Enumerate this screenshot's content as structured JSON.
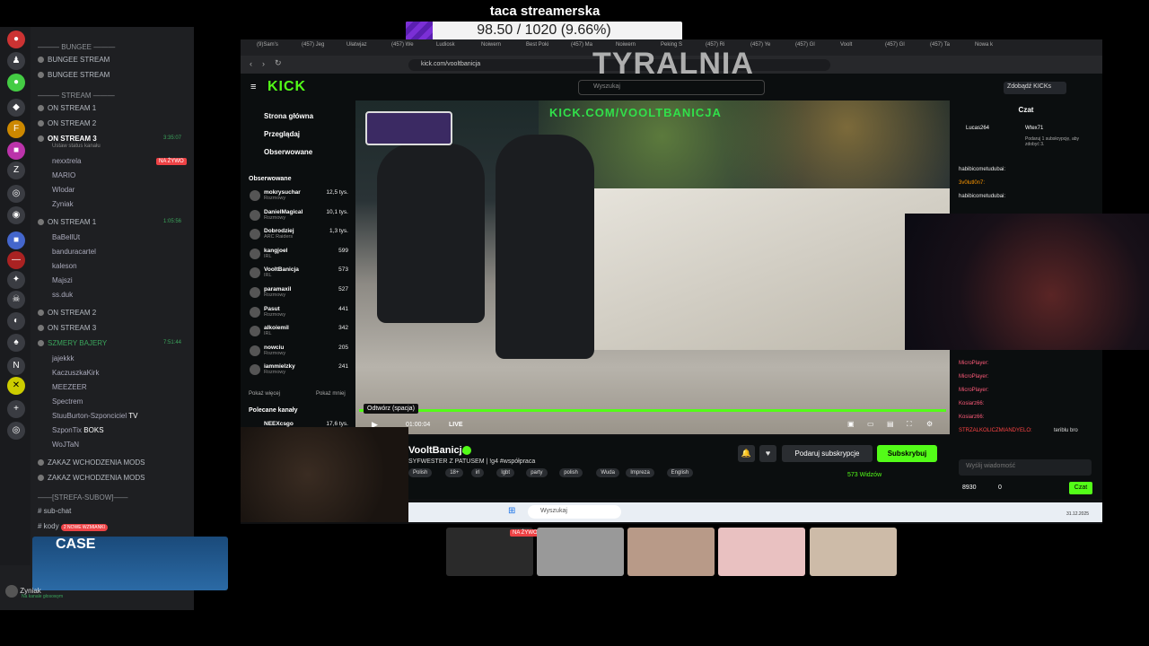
{
  "goal": {
    "title": "taca streamerska",
    "progress_text": "98.50 / 1020 (9.66%)",
    "progress_fraction": 0.0966
  },
  "discord": {
    "categories": {
      "bungee": "BUNGEE",
      "stream": "STREAM",
      "strefa": "STREFA-SUBOW"
    },
    "channels": {
      "bungee1": "BUNGEE STREAM",
      "bungee2": "BUNGEE STREAM",
      "on1": "ON STREAM 1",
      "on2": "ON STREAM 2",
      "on3": "ON STREAM 3",
      "on3_sub": "Ustaw status kanału",
      "on1b": "ON STREAM 1",
      "on2b": "ON STREAM 2",
      "on3b": "ON STREAM 3",
      "szmery": "SZMERY BAJERY",
      "zakaz1": "ZAKAZ WCHODZENIA MODS",
      "zakaz2": "ZAKAZ WCHODZENIA MODS",
      "subchat": "sub-chat",
      "kody": "kody",
      "nowe": "2 NOWE WZMIANKI"
    },
    "times": {
      "on3": "3:35:07",
      "on1b": "1:05:56",
      "szmery": "7:51:44"
    },
    "live_badge": "NA ŻYWO",
    "users_on3": [
      "nexxtrela",
      "MARIO",
      "Wlodar",
      "Zyniak"
    ],
    "users_on1": [
      "BaBellUt",
      "banduracartel",
      "kaleson",
      "Majszi",
      "ss.duk"
    ],
    "users_szmery": [
      "jajekkk",
      "KaczuszkaKirk",
      "MEEZEER",
      "Spectrem",
      "StuuBurton-Szponciciel",
      "SzponTix",
      "WoJTaN"
    ],
    "tags": {
      "tv": "TV",
      "boks": "BOKS"
    },
    "case_label": "CASE",
    "user_name": "Zyniak",
    "user_status": "Na kanale głosowym"
  },
  "browser": {
    "tabs": [
      "(9)Sam's",
      "(457) Jeg",
      "Ułatwjaz",
      "(457) We",
      "Ludiosk",
      "Noiwern",
      "Best Poki",
      "(457) Ma",
      "Noiwern",
      "Peking S",
      "(457) Ri",
      "(457) Ye",
      "(457) Gl",
      "Voolt",
      "(457) Gl",
      "(457) Ta",
      "Nowa k"
    ],
    "url": "kick.com/vooltbanicja",
    "overlay_text": "TYRALNIA"
  },
  "kick": {
    "search_placeholder": "Wyszukaj",
    "coins": "Zdobądź KICKs",
    "nav": [
      "Strona główna",
      "Przeglądaj",
      "Obserwowane"
    ],
    "following_title": "Obserwowane",
    "following": [
      {
        "name": "mokrysuchar",
        "cat": "Rozmowy",
        "count": "12,5 tys."
      },
      {
        "name": "DanielMagical",
        "cat": "Rozmowy",
        "count": "10,1 tys."
      },
      {
        "name": "Dobrodziej",
        "cat": "ARC Raiders",
        "count": "1,3 tys."
      },
      {
        "name": "kangjoel",
        "cat": "IRL",
        "count": "599"
      },
      {
        "name": "VooltBanicja",
        "cat": "IRL",
        "count": "573"
      },
      {
        "name": "paramaxil",
        "cat": "Rozmowy",
        "count": "527"
      },
      {
        "name": "Pasut",
        "cat": "Rozmowy",
        "count": "441"
      },
      {
        "name": "alkoiemil",
        "cat": "IRL",
        "count": "342"
      },
      {
        "name": "nowciu",
        "cat": "Rozmowy",
        "count": "205"
      },
      {
        "name": "iammielzky",
        "cat": "Rozmowy",
        "count": "241"
      }
    ],
    "show_more": "Pokaż więcej",
    "show_less": "Pokaż mniej",
    "recommended_title": "Polecane kanały",
    "recommended_first": {
      "name": "NEEXcsgo",
      "count": "17,6 tys."
    },
    "video_banner": "KICK.COM/VOOLTBANICJA",
    "tooltip": "Odtwórz (spacja)",
    "video_time": "01:00:04",
    "video_live": "LIVE",
    "progress": 1.0,
    "channel_name": "VooltBanicja",
    "stream_title": "SYFWESTER Z PATUSEM | !g4 #współpraca",
    "tags": [
      "Polish",
      "18+",
      "irl",
      "lgbt",
      "party",
      "polish",
      "Wuda",
      "Impreza",
      "English"
    ],
    "subscribe": "Podaruj subskrypcje",
    "follow": "Subskrybuj",
    "viewers": "573 Widzów"
  },
  "chat": {
    "title": "Czat",
    "pinned": [
      {
        "name": "Lucas264",
        "v": "1"
      },
      {
        "name": "Wtex71",
        "v": "1"
      }
    ],
    "pinned_text": "Podaruj 1 subskrypcję, aby zdobyć 3.",
    "messages": [
      {
        "name": "habibicometudubai:",
        "color": "#e6e6e6"
      },
      {
        "name": "3v0lutl0n7:",
        "color": "#ff9800"
      },
      {
        "name": "habibicometudubai:",
        "color": "#e6e6e6"
      },
      {
        "name": "MicroPlayer:",
        "color": "#ff5b7a"
      },
      {
        "name": "MicroPlayer:",
        "color": "#ff5b7a"
      },
      {
        "name": "MicroPlayer:",
        "color": "#ff5b7a"
      },
      {
        "name": "Kosiarz66:",
        "color": "#ff5b7a"
      },
      {
        "name": "Kosiarz66:",
        "color": "#ff5b7a"
      },
      {
        "name": "STRZALKOLICZMIANDYELO:",
        "color": "#f44"
      }
    ],
    "last_text": "teriblu bro",
    "input_placeholder": "Wyślij wiadomość",
    "points": "8930",
    "points2": "0",
    "send": "Czat"
  },
  "taskbar": {
    "search": "Wyszukaj",
    "date": "31.12.2025"
  },
  "thumbs": {
    "live_badge": "NA ŻYWO"
  }
}
